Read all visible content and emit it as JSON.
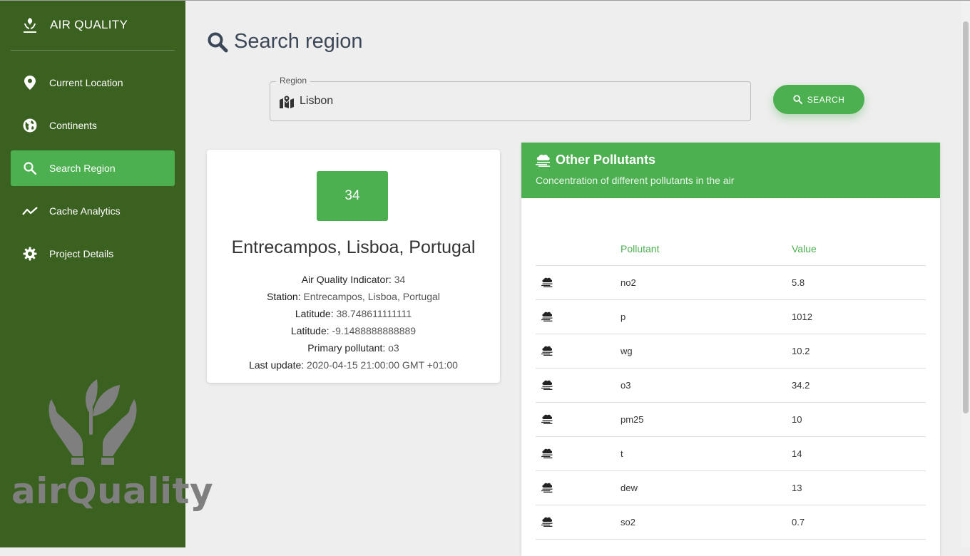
{
  "app": {
    "title": "AIR QUALITY",
    "logo_text": "airQuality"
  },
  "sidebar": {
    "items": [
      {
        "label": "Current Location",
        "icon": "location-pin-icon",
        "active": false
      },
      {
        "label": "Continents",
        "icon": "globe-icon",
        "active": false
      },
      {
        "label": "Search Region",
        "icon": "search-icon",
        "active": true
      },
      {
        "label": "Cache Analytics",
        "icon": "trending-icon",
        "active": false
      },
      {
        "label": "Project Details",
        "icon": "gear-icon",
        "active": false
      }
    ],
    "watermark_text": "airQuality"
  },
  "page": {
    "title": "Search region"
  },
  "search": {
    "legend": "Region",
    "value": "Lisbon",
    "button_label": "SEARCH"
  },
  "station": {
    "aqi": "34",
    "name": "Entrecampos, Lisboa, Portugal",
    "details": [
      {
        "key": "Air Quality Indicator:",
        "value": "34"
      },
      {
        "key": "Station:",
        "value": "Entrecampos, Lisboa, Portugal"
      },
      {
        "key": "Latitude:",
        "value": "38.748611111111"
      },
      {
        "key": "Latitude:",
        "value": "-9.1488888888889"
      },
      {
        "key": "Primary pollutant:",
        "value": "o3"
      },
      {
        "key": "Last update:",
        "value": "2020-04-15 21:00:00 GMT +01:00"
      }
    ]
  },
  "pollutants": {
    "title": "Other Pollutants",
    "subtitle": "Concentration of different pollutants in the air",
    "columns": [
      "",
      "Pollutant",
      "Value"
    ],
    "rows": [
      {
        "name": "no2",
        "value": "5.8"
      },
      {
        "name": "p",
        "value": "1012"
      },
      {
        "name": "wg",
        "value": "10.2"
      },
      {
        "name": "o3",
        "value": "34.2"
      },
      {
        "name": "pm25",
        "value": "10"
      },
      {
        "name": "t",
        "value": "14"
      },
      {
        "name": "dew",
        "value": "13"
      },
      {
        "name": "so2",
        "value": "0.7"
      }
    ]
  },
  "colors": {
    "sidebar_bg": "#3b6120",
    "accent": "#4caf50",
    "page_bg": "#eeeeee"
  }
}
